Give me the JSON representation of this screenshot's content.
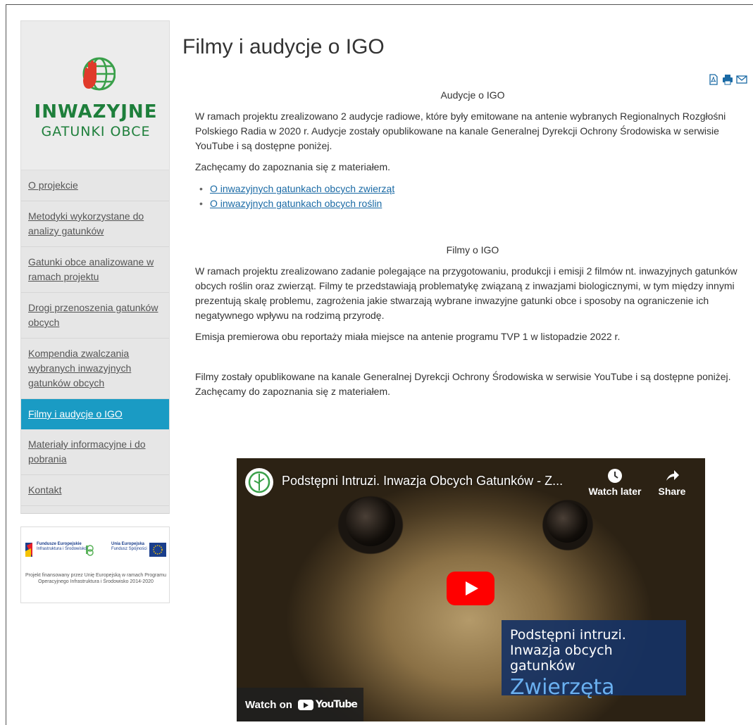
{
  "sidebar": {
    "logo_line1": "INWAZYJNE",
    "logo_line2": "GATUNKI OBCE",
    "menu": [
      {
        "label": "O projekcie",
        "active": false
      },
      {
        "label": "Metodyki wykorzystane do analizy gatunków",
        "active": false
      },
      {
        "label": "Gatunki obce analizowane w ramach projektu",
        "active": false
      },
      {
        "label": "Drogi przenoszenia gatunków obcych",
        "active": false
      },
      {
        "label": "Kompendia zwalczania wybranych inwazyjnych gatunków obcych",
        "active": false
      },
      {
        "label": "Filmy i audycje o IGO",
        "active": true
      },
      {
        "label": "Materiały informacyjne i do pobrania",
        "active": false
      },
      {
        "label": "Kontakt",
        "active": false
      }
    ],
    "eu": {
      "left_logo": "Fundusze Europejskie",
      "left_sub": "Infrastruktura i Środowisko",
      "right_logo": "Unia Europejska",
      "right_sub": "Fundusz Spójności",
      "caption": "Projekt finansowany przez Unię Europejską w ramach Programu Operacyjnego Infrastruktura i Środowisko 2014-2020"
    }
  },
  "main": {
    "title": "Filmy i audycje o IGO",
    "audio_heading": "Audycje o IGO",
    "audio_p1": "W ramach projektu zrealizowano 2 audycje radiowe, które były emitowane na antenie wybranych Regionalnych Rozgłośni Polskiego Radia w 2020 r. Audycje zostały opublikowane na kanale Generalnej Dyrekcji Ochrony Środowiska w serwisie YouTube i są dostępne poniżej.",
    "audio_p2": "Zachęcamy do zapoznania się z materiałem.",
    "links": [
      "O inwazyjnych gatunkach obcych zwierząt",
      "O inwazyjnych gatunkach obcych roślin"
    ],
    "film_heading": "Filmy o IGO",
    "film_p1": "W ramach projektu zrealizowano zadanie polegające na przygotowaniu, produkcji i emisji 2 filmów nt. inwazyjnych gatunków obcych roślin oraz zwierząt. Filmy te przedstawiają problematykę związaną z inwazjami biologicznymi, w tym między innymi prezentują skalę problemu, zagrożenia jakie stwarzają wybrane inwazyjne gatunki obce i sposoby na ograniczenie ich negatywnego wpływu na rodzimą przyrodę.",
    "film_p2": "Emisja premierowa obu reportaży miała miejsce na antenie programu TVP 1 w listopadzie 2022 r.",
    "film_p3": "Filmy zostały opublikowane na kanale Generalnej Dyrekcji Ochrony Środowiska w serwisie YouTube i są dostępne poniżej.",
    "film_p4": "Zachęcamy do zapoznania się z materiałem."
  },
  "video": {
    "title": "Podstępni Intruzi. Inwazja Obcych Gatunków - Z...",
    "watch_later": "Watch later",
    "share": "Share",
    "box_line1": "Podstępni intruzi.",
    "box_line2": "Inwazja obcych gatunków",
    "box_line3": "Zwierzęta",
    "watch_on": "Watch on",
    "youtube": "YouTube"
  },
  "colors": {
    "active_menu": "#1a9bc4",
    "logo_green": "#1e7f3b",
    "link": "#1a6aa5",
    "play_red": "#ff0000"
  }
}
